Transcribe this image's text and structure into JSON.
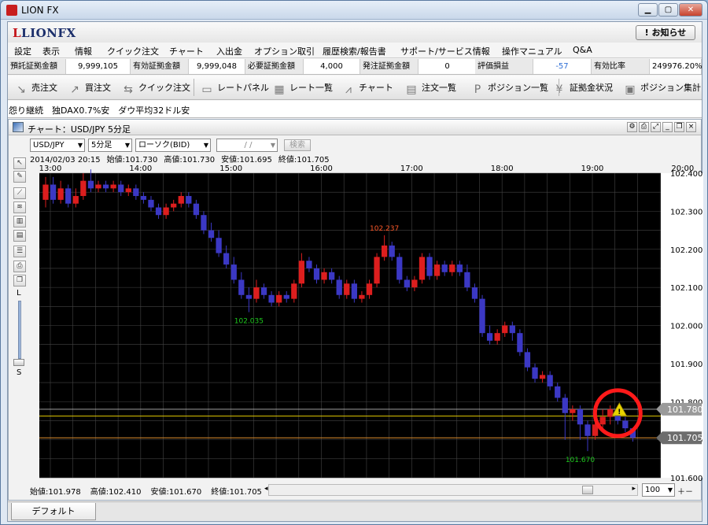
{
  "window": {
    "title": "LION FX"
  },
  "brand": {
    "mark": "L",
    "name": "LIONFX"
  },
  "notice_button": "! お知らせ",
  "menu": [
    "設定",
    "表示",
    "情報",
    "クイック注文",
    "チャート",
    "入出金",
    "オプション取引",
    "履歴検索/報告書",
    "サポート/サービス情報",
    "操作マニュアル",
    "Q&A"
  ],
  "status": [
    {
      "label": "預託証拠金額",
      "value": "9,999,105"
    },
    {
      "label": "有効証拠金額",
      "value": "9,999,048"
    },
    {
      "label": "必要証拠金額",
      "value": "4,000"
    },
    {
      "label": "発注証拠金額",
      "value": "0"
    },
    {
      "label": "評価損益",
      "value": "-57"
    },
    {
      "label": "有効比率",
      "value": "249976.20%"
    }
  ],
  "toolbar": [
    {
      "label": "売注文",
      "icon": "sell-arrow-icon"
    },
    {
      "label": "買注文",
      "icon": "buy-arrow-icon"
    },
    {
      "label": "クイック注文",
      "icon": "quick-order-icon"
    },
    {
      "label": "レートパネル",
      "icon": "rate-panel-icon"
    },
    {
      "label": "レート一覧",
      "icon": "rate-list-icon"
    },
    {
      "label": "チャート",
      "icon": "chart-icon"
    },
    {
      "label": "注文一覧",
      "icon": "order-list-icon"
    },
    {
      "label": "ポジション一覧",
      "icon": "position-list-icon"
    },
    {
      "label": "証拠金状況",
      "icon": "yen-icon"
    },
    {
      "label": "ポジション集計",
      "icon": "position-summary-icon"
    }
  ],
  "ticker": "怨り継続　独DAX0.7%安　ダウ平均32ドル安",
  "chart_window": {
    "title": "チャート：USD/JPY 5分足",
    "pair": "USD/JPY",
    "timeframe": "5分足",
    "chart_kind": "ローソク(BID)",
    "date_input": "/ /",
    "search_label": "検索",
    "ohlc_line": [
      "2014/02/03 20:15",
      "始値:101.730",
      "高値:101.730",
      "安値:101.695",
      "終値:101.705"
    ],
    "footer": [
      "始値:101.978",
      "高値:102.410",
      "安値:101.670",
      "終値:101.705"
    ],
    "zoom_value": "100",
    "zoom_top": "L",
    "zoom_bottom": "S"
  },
  "tabs": [
    "デフォルト"
  ],
  "chart_data": {
    "type": "candlestick",
    "x_labels": [
      "13:00",
      "14:00",
      "15:00",
      "16:00",
      "17:00",
      "18:00",
      "19:00",
      "20:00"
    ],
    "y_ticks": [
      "102.400",
      "102.300",
      "102.200",
      "102.100",
      "102.000",
      "101.900",
      "101.800",
      "101.700",
      "101.600"
    ],
    "ylim": [
      101.6,
      102.4
    ],
    "current_price_labels": [
      "101.780",
      "101.705"
    ],
    "horizontal_lines": [
      101.78,
      101.762,
      101.705
    ],
    "annotations": [
      {
        "text": "102.237",
        "value": 102.237,
        "bar": 45,
        "color": "#ff5a2a"
      },
      {
        "text": "102.035",
        "value": 102.035,
        "bar": 27,
        "color": "#1ec81e"
      },
      {
        "text": "101.670",
        "value": 101.67,
        "bar": 71,
        "color": "#1ec81e"
      }
    ],
    "colors": {
      "up": "#dd1e1e",
      "down": "#3b38c4",
      "background": "#000000",
      "grid": "#444444",
      "highlight": "#ff1a1a",
      "alert": "#e8d400"
    },
    "candles": [
      {
        "o": 102.33,
        "c": 102.37,
        "h": 102.39,
        "l": 102.31
      },
      {
        "o": 102.37,
        "c": 102.33,
        "h": 102.39,
        "l": 102.32
      },
      {
        "o": 102.33,
        "c": 102.36,
        "h": 102.38,
        "l": 102.32
      },
      {
        "o": 102.36,
        "c": 102.32,
        "h": 102.37,
        "l": 102.31
      },
      {
        "o": 102.32,
        "c": 102.34,
        "h": 102.36,
        "l": 102.31
      },
      {
        "o": 102.34,
        "c": 102.38,
        "h": 102.4,
        "l": 102.33
      },
      {
        "o": 102.38,
        "c": 102.36,
        "h": 102.41,
        "l": 102.35
      },
      {
        "o": 102.36,
        "c": 102.37,
        "h": 102.38,
        "l": 102.35
      },
      {
        "o": 102.37,
        "c": 102.36,
        "h": 102.38,
        "l": 102.35
      },
      {
        "o": 102.36,
        "c": 102.37,
        "h": 102.38,
        "l": 102.35
      },
      {
        "o": 102.37,
        "c": 102.35,
        "h": 102.38,
        "l": 102.34
      },
      {
        "o": 102.35,
        "c": 102.36,
        "h": 102.37,
        "l": 102.34
      },
      {
        "o": 102.36,
        "c": 102.34,
        "h": 102.37,
        "l": 102.33
      },
      {
        "o": 102.34,
        "c": 102.33,
        "h": 102.35,
        "l": 102.32
      },
      {
        "o": 102.33,
        "c": 102.31,
        "h": 102.34,
        "l": 102.3
      },
      {
        "o": 102.31,
        "c": 102.29,
        "h": 102.32,
        "l": 102.28
      },
      {
        "o": 102.29,
        "c": 102.31,
        "h": 102.32,
        "l": 102.28
      },
      {
        "o": 102.31,
        "c": 102.32,
        "h": 102.33,
        "l": 102.3
      },
      {
        "o": 102.32,
        "c": 102.34,
        "h": 102.35,
        "l": 102.31
      },
      {
        "o": 102.34,
        "c": 102.32,
        "h": 102.35,
        "l": 102.31
      },
      {
        "o": 102.32,
        "c": 102.29,
        "h": 102.33,
        "l": 102.28
      },
      {
        "o": 102.29,
        "c": 102.25,
        "h": 102.3,
        "l": 102.24
      },
      {
        "o": 102.25,
        "c": 102.23,
        "h": 102.27,
        "l": 102.22
      },
      {
        "o": 102.23,
        "c": 102.19,
        "h": 102.25,
        "l": 102.18
      },
      {
        "o": 102.19,
        "c": 102.16,
        "h": 102.21,
        "l": 102.15
      },
      {
        "o": 102.16,
        "c": 102.12,
        "h": 102.18,
        "l": 102.11
      },
      {
        "o": 102.12,
        "c": 102.08,
        "h": 102.14,
        "l": 102.07
      },
      {
        "o": 102.08,
        "c": 102.07,
        "h": 102.1,
        "l": 102.035
      },
      {
        "o": 102.07,
        "c": 102.1,
        "h": 102.12,
        "l": 102.06
      },
      {
        "o": 102.1,
        "c": 102.08,
        "h": 102.11,
        "l": 102.07
      },
      {
        "o": 102.08,
        "c": 102.06,
        "h": 102.09,
        "l": 102.05
      },
      {
        "o": 102.06,
        "c": 102.08,
        "h": 102.09,
        "l": 102.05
      },
      {
        "o": 102.08,
        "c": 102.07,
        "h": 102.09,
        "l": 102.06
      },
      {
        "o": 102.07,
        "c": 102.11,
        "h": 102.12,
        "l": 102.06
      },
      {
        "o": 102.11,
        "c": 102.17,
        "h": 102.19,
        "l": 102.1
      },
      {
        "o": 102.17,
        "c": 102.15,
        "h": 102.18,
        "l": 102.14
      },
      {
        "o": 102.15,
        "c": 102.12,
        "h": 102.16,
        "l": 102.11
      },
      {
        "o": 102.12,
        "c": 102.14,
        "h": 102.15,
        "l": 102.11
      },
      {
        "o": 102.14,
        "c": 102.12,
        "h": 102.15,
        "l": 102.11
      },
      {
        "o": 102.12,
        "c": 102.08,
        "h": 102.13,
        "l": 102.07
      },
      {
        "o": 102.08,
        "c": 102.11,
        "h": 102.12,
        "l": 102.07
      },
      {
        "o": 102.11,
        "c": 102.07,
        "h": 102.12,
        "l": 102.06
      },
      {
        "o": 102.07,
        "c": 102.08,
        "h": 102.09,
        "l": 102.06
      },
      {
        "o": 102.08,
        "c": 102.11,
        "h": 102.12,
        "l": 102.07
      },
      {
        "o": 102.11,
        "c": 102.18,
        "h": 102.19,
        "l": 102.1
      },
      {
        "o": 102.18,
        "c": 102.21,
        "h": 102.237,
        "l": 102.17
      },
      {
        "o": 102.21,
        "c": 102.18,
        "h": 102.22,
        "l": 102.17
      },
      {
        "o": 102.18,
        "c": 102.12,
        "h": 102.19,
        "l": 102.11
      },
      {
        "o": 102.12,
        "c": 102.1,
        "h": 102.13,
        "l": 102.09
      },
      {
        "o": 102.1,
        "c": 102.12,
        "h": 102.13,
        "l": 102.09
      },
      {
        "o": 102.12,
        "c": 102.18,
        "h": 102.19,
        "l": 102.11
      },
      {
        "o": 102.18,
        "c": 102.13,
        "h": 102.19,
        "l": 102.12
      },
      {
        "o": 102.13,
        "c": 102.16,
        "h": 102.17,
        "l": 102.12
      },
      {
        "o": 102.16,
        "c": 102.14,
        "h": 102.17,
        "l": 102.13
      },
      {
        "o": 102.14,
        "c": 102.16,
        "h": 102.17,
        "l": 102.13
      },
      {
        "o": 102.16,
        "c": 102.14,
        "h": 102.17,
        "l": 102.13
      },
      {
        "o": 102.14,
        "c": 102.1,
        "h": 102.16,
        "l": 102.09
      },
      {
        "o": 102.1,
        "c": 102.07,
        "h": 102.11,
        "l": 102.06
      },
      {
        "o": 102.07,
        "c": 101.98,
        "h": 102.08,
        "l": 101.97
      },
      {
        "o": 101.98,
        "c": 101.96,
        "h": 102.0,
        "l": 101.95
      },
      {
        "o": 101.96,
        "c": 101.98,
        "h": 101.99,
        "l": 101.95
      },
      {
        "o": 101.98,
        "c": 102.0,
        "h": 102.01,
        "l": 101.97
      },
      {
        "o": 102.0,
        "c": 101.98,
        "h": 102.01,
        "l": 101.96
      },
      {
        "o": 101.98,
        "c": 101.93,
        "h": 101.99,
        "l": 101.92
      },
      {
        "o": 101.93,
        "c": 101.89,
        "h": 101.94,
        "l": 101.88
      },
      {
        "o": 101.89,
        "c": 101.86,
        "h": 101.9,
        "l": 101.85
      },
      {
        "o": 101.86,
        "c": 101.87,
        "h": 101.88,
        "l": 101.85
      },
      {
        "o": 101.87,
        "c": 101.84,
        "h": 101.88,
        "l": 101.83
      },
      {
        "o": 101.84,
        "c": 101.81,
        "h": 101.85,
        "l": 101.8
      },
      {
        "o": 101.81,
        "c": 101.77,
        "h": 101.82,
        "l": 101.7
      },
      {
        "o": 101.77,
        "c": 101.78,
        "h": 101.79,
        "l": 101.75
      },
      {
        "o": 101.78,
        "c": 101.74,
        "h": 101.79,
        "l": 101.7
      },
      {
        "o": 101.74,
        "c": 101.71,
        "h": 101.75,
        "l": 101.67
      },
      {
        "o": 101.71,
        "c": 101.74,
        "h": 101.76,
        "l": 101.7
      },
      {
        "o": 101.74,
        "c": 101.76,
        "h": 101.78,
        "l": 101.72
      },
      {
        "o": 101.76,
        "c": 101.78,
        "h": 101.79,
        "l": 101.74
      },
      {
        "o": 101.78,
        "c": 101.75,
        "h": 101.79,
        "l": 101.74
      },
      {
        "o": 101.75,
        "c": 101.73,
        "h": 101.76,
        "l": 101.72
      },
      {
        "o": 101.73,
        "c": 101.705,
        "h": 101.73,
        "l": 101.695
      }
    ]
  }
}
